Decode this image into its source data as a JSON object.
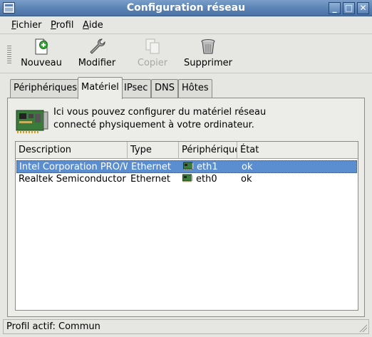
{
  "window": {
    "title": "Configuration réseau"
  },
  "menu": {
    "items": [
      "Fichier",
      "Profil",
      "Aide"
    ]
  },
  "toolbar": {
    "new_label": "Nouveau",
    "edit_label": "Modifier",
    "copy_label": "Copier",
    "delete_label": "Supprimer"
  },
  "tabs": [
    "Périphériques",
    "Matériel",
    "IPsec",
    "DNS",
    "Hôtes"
  ],
  "active_tab": "Matériel",
  "info": {
    "line1": "Ici vous pouvez configurer du matériel réseau",
    "line2": "connecté physiquement à votre ordinateur."
  },
  "table": {
    "columns": [
      "Description",
      "Type",
      "Périphérique",
      "État"
    ],
    "rows": [
      {
        "description": "Intel Corporation PRO/W",
        "type": "Ethernet",
        "device": "eth1",
        "state": "ok",
        "selected": true
      },
      {
        "description": "Realtek Semiconductor",
        "type": "Ethernet",
        "device": "eth0",
        "state": "ok",
        "selected": false
      }
    ]
  },
  "status": {
    "text": "Profil actif: Commun"
  },
  "colors": {
    "titlebar": "#5a82b4",
    "selection": "#5b8ed0",
    "window_bg": "#e6e6e3"
  }
}
